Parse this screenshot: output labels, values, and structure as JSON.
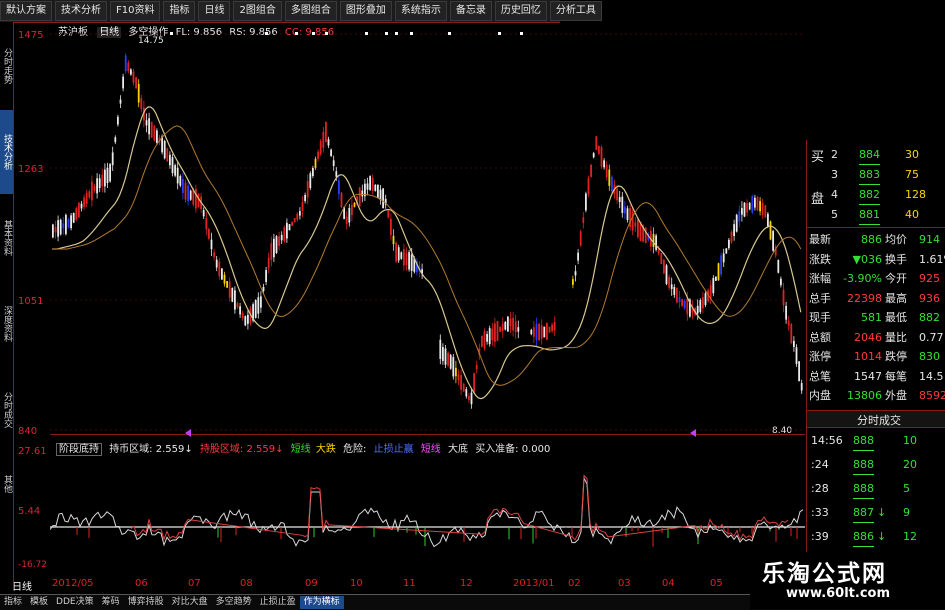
{
  "toolbar": {
    "buttons": [
      "默认方案",
      "技术分析",
      "F10资料",
      "指标",
      "日线",
      "2图组合",
      "多图组合",
      "图形叠加",
      "系统指示",
      "备忘录",
      "历史回忆",
      "分析工具"
    ]
  },
  "sidetabs": [
    "分时走势",
    "技术分析",
    "基本资料",
    "深度资料",
    "分时成交",
    "其他"
  ],
  "price_axis": [
    "1475",
    "1263",
    "1051",
    "840"
  ],
  "price_header": {
    "stock": "苏沪板",
    "period": "日线",
    "mode": "多空操作",
    "fl": "FL: 9.856",
    "rs": "RS: 9.856",
    "cc": "CC: 9.856",
    "high_marker": "14.75",
    "low_marker": "8.40"
  },
  "indicator_header": {
    "name": "阶段底持",
    "hold": "持币区域: 2.559↓",
    "hold2": "持股区域: 2.559↓",
    "b1": "短线",
    "b2": "大跌",
    "danger": "危险:",
    "b3": "止损止赢",
    "b4": "短线",
    "b5": "大底",
    "buy": "买入准备: 0.000"
  },
  "indicator_axis": [
    "27.61",
    "5.44",
    "-16.72"
  ],
  "dates": [
    "2012/05",
    "06",
    "07",
    "08",
    "09",
    "10",
    "11",
    "12",
    "2013/01",
    "02",
    "03",
    "04",
    "05"
  ],
  "period_label": "日线",
  "right_panel": {
    "buy_label": "买",
    "sell_label": "盘",
    "depth": [
      {
        "lvl": "2",
        "price": "884",
        "vol": "30"
      },
      {
        "lvl": "3",
        "price": "883",
        "vol": "75"
      },
      {
        "lvl": "4",
        "price": "882",
        "vol": "128"
      },
      {
        "lvl": "5",
        "price": "881",
        "vol": "40"
      }
    ],
    "quote_left": [
      {
        "k": "最新",
        "v": "886"
      },
      {
        "k": "涨跌",
        "v": "▼036"
      },
      {
        "k": "涨幅",
        "v": "-3.90%"
      },
      {
        "k": "总手",
        "v": "22398"
      },
      {
        "k": "现手",
        "v": "581"
      },
      {
        "k": "总额",
        "v": "2046"
      },
      {
        "k": "涨停",
        "v": "1014"
      },
      {
        "k": "总笔",
        "v": "1547"
      },
      {
        "k": "内盘",
        "v": "13806"
      }
    ],
    "quote_right": [
      {
        "k": "均价",
        "v": "914"
      },
      {
        "k": "换手",
        "v": "1.61%"
      },
      {
        "k": "今开",
        "v": "925"
      },
      {
        "k": "最高",
        "v": "936"
      },
      {
        "k": "最低",
        "v": "882"
      },
      {
        "k": "量比",
        "v": "0.77"
      },
      {
        "k": "跌停",
        "v": "830"
      },
      {
        "k": "每笔",
        "v": "14.5"
      },
      {
        "k": "外盘",
        "v": "8592"
      }
    ],
    "ticks_title": "分时成交",
    "ticks": [
      {
        "t": "14:56",
        "p": "888",
        "v": "10",
        "d": ""
      },
      {
        "t": ":24",
        "p": "888",
        "v": "20",
        "d": ""
      },
      {
        "t": ":28",
        "p": "888",
        "v": "5",
        "d": ""
      },
      {
        "t": ":33",
        "p": "887",
        "v": "9",
        "d": "↓"
      },
      {
        "t": ":39",
        "p": "886",
        "v": "12",
        "d": "↓"
      },
      {
        "t": "14:57",
        "p": "886",
        "v": "",
        "d": ""
      }
    ]
  },
  "bottom_tabs": [
    "指标",
    "模板",
    "DDE决策",
    "筹码",
    "博弈持股",
    "对比大盘",
    "多空趋势",
    "止损止盈",
    "作为横标"
  ],
  "watermark": {
    "title": "乐淘公式网",
    "url": "www.60lt.com"
  }
}
